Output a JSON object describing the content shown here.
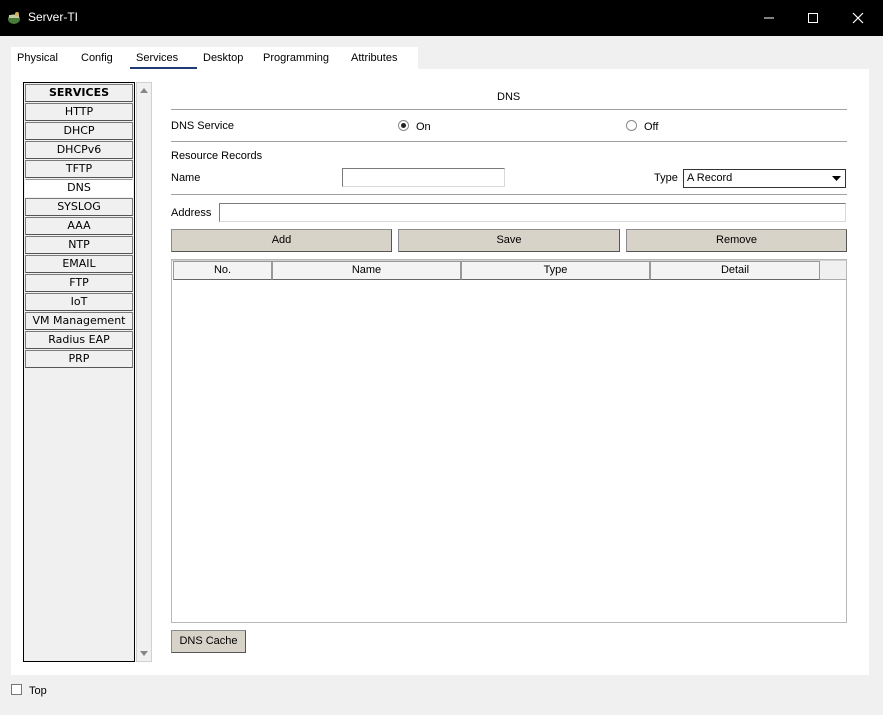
{
  "window": {
    "title": "Server-TI"
  },
  "tabs": [
    {
      "label": "Physical"
    },
    {
      "label": "Config"
    },
    {
      "label": "Services",
      "active": true
    },
    {
      "label": "Desktop"
    },
    {
      "label": "Programming"
    },
    {
      "label": "Attributes"
    }
  ],
  "services": {
    "header": "SERVICES",
    "items": [
      "HTTP",
      "DHCP",
      "DHCPv6",
      "TFTP",
      "DNS",
      "SYSLOG",
      "AAA",
      "NTP",
      "EMAIL",
      "FTP",
      "IoT",
      "VM Management",
      "Radius EAP",
      "PRP"
    ],
    "active": "DNS"
  },
  "dns": {
    "section_title": "DNS",
    "service_label": "DNS Service",
    "on_label": "On",
    "off_label": "Off",
    "service_state": "On",
    "resource_records_label": "Resource Records",
    "name_label": "Name",
    "name_value": "",
    "type_label": "Type",
    "type_value": "A Record",
    "address_label": "Address",
    "address_value": "",
    "add_button": "Add",
    "save_button": "Save",
    "remove_button": "Remove",
    "table_columns": [
      "No.",
      "Name",
      "Type",
      "Detail"
    ],
    "cache_button": "DNS Cache"
  },
  "footer": {
    "top_label": "Top",
    "top_checked": false
  }
}
